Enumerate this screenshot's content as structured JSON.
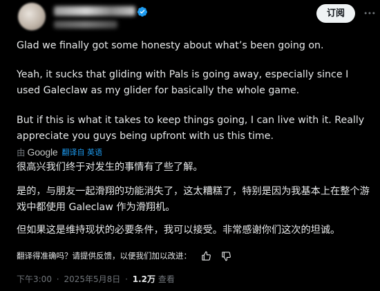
{
  "header": {
    "subscribe_label": "订阅"
  },
  "post": {
    "paragraphs": [
      "Glad we finally got some honesty about what’s been going on.",
      "Yeah, it sucks that gliding with Pals is going away, especially since I used Galeclaw as my glider for basically the whole game.",
      "But if this is what it takes to keep things going, I can live with it. Really appreciate you guys being upfront with us this time."
    ]
  },
  "translation": {
    "by_label": "由",
    "google_label": "Google",
    "link_label": "翻译自 英语",
    "paragraphs": [
      "很高兴我们终于对发生的事情有了些了解。",
      "是的，与朋友一起滑翔的功能消失了，这太糟糕了，特别是因为我基本上在整个游戏中都使用 Galeclaw 作为滑翔机。",
      "但如果这是维持现状的必要条件，我可以接受。非常感谢你们这次的坦诚。"
    ],
    "feedback_prompt": "翻译得准确吗？请提供反馈，以便我们加以改进："
  },
  "meta": {
    "time": "下午3:00",
    "separator": "·",
    "date": "2025年5月8日",
    "views_count": "1.2万",
    "views_label": "查看"
  },
  "colors": {
    "background": "#000000",
    "text": "#e7e9ea",
    "muted": "#71767b",
    "link": "#1d9bf0",
    "verified": "#1d9bf0",
    "button_bg": "#eff3f4"
  },
  "icons": {
    "verified": "verified-badge-icon",
    "more": "more-options-icon",
    "thumbs_up": "thumbs-up-icon",
    "thumbs_down": "thumbs-down-icon"
  }
}
